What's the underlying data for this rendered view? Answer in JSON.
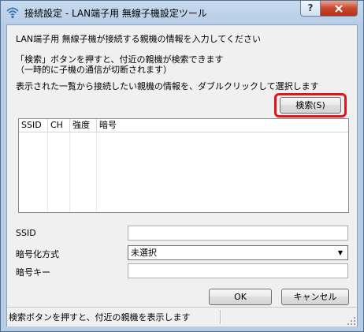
{
  "window": {
    "title": "接続設定 - LAN端子用 無線子機設定ツール",
    "help_label": "?",
    "close_label": "X",
    "app_icon": "wifi-icon"
  },
  "instructions": {
    "line1": "LAN端子用 無線子機が接続する親機の情報を入力してください",
    "line2": "「検索」ボタンを押すと、付近の親機が検索できます",
    "line3": "（一時的に子機の通信が切断されます）",
    "line4": "表示された一覧から接続したい親機の情報を、ダブルクリックして選択します"
  },
  "search_button": {
    "label": "検索(S)",
    "highlight_color": "#e0141e"
  },
  "network_list": {
    "columns": [
      "SSID",
      "CH",
      "強度",
      "暗号"
    ],
    "rows": []
  },
  "form": {
    "ssid_label": "SSID",
    "ssid_value": "",
    "encryption_label": "暗号化方式",
    "encryption_value": "未選択",
    "key_label": "暗号キー",
    "key_value": ""
  },
  "buttons": {
    "ok_label": "OK",
    "cancel_label": "キャンセル"
  },
  "status": {
    "text": "検索ボタンを押すと、付近の親機を表示します"
  }
}
